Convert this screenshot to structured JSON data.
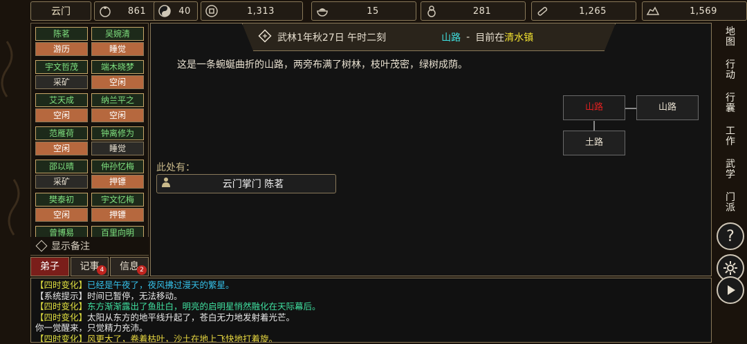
{
  "topbar": {
    "sect": "云门",
    "resources": [
      {
        "icon": "treasure-bag-icon",
        "value": "861"
      },
      {
        "icon": "yin-yang-icon",
        "value": "40"
      },
      {
        "icon": "coin-icon",
        "value": "1,313"
      },
      {
        "icon": "food-bowl-icon",
        "value": "15"
      },
      {
        "icon": "gourd-icon",
        "value": "281"
      },
      {
        "icon": "wood-log-icon",
        "value": "1,265"
      },
      {
        "icon": "ore-rock-icon",
        "value": "1,569"
      }
    ]
  },
  "disciples": [
    {
      "name": "陈茗",
      "status": "游历",
      "busy": true
    },
    {
      "name": "吴婉清",
      "status": "睡觉",
      "busy": true
    },
    {
      "name": "宇文哲茂",
      "status": "采矿",
      "busy": false
    },
    {
      "name": "端木晓梦",
      "status": "空闲",
      "busy": true
    },
    {
      "name": "艾天成",
      "status": "空闲",
      "busy": true
    },
    {
      "name": "纳兰平之",
      "status": "空闲",
      "busy": true
    },
    {
      "name": "范雁荷",
      "status": "空闲",
      "busy": true
    },
    {
      "name": "钟离修为",
      "status": "睡觉",
      "busy": false
    },
    {
      "name": "邵以晴",
      "status": "采矿",
      "busy": false
    },
    {
      "name": "仲孙忆梅",
      "status": "押镖",
      "busy": true
    },
    {
      "name": "樊泰初",
      "status": "空闲",
      "busy": true
    },
    {
      "name": "宇文忆梅",
      "status": "押镖",
      "busy": true
    },
    {
      "name": "曾博易",
      "status": "",
      "busy": true
    },
    {
      "name": "百里向明",
      "status": "",
      "busy": true
    }
  ],
  "memo_toggle": "显示备注",
  "tabs": [
    {
      "label": "弟子",
      "badge": ""
    },
    {
      "label": "记事",
      "badge": "4"
    },
    {
      "label": "信息",
      "badge": "2"
    }
  ],
  "header": {
    "date": "武林1年秋27日 午时二刻",
    "location": "山路",
    "separator": "-",
    "now_prefix": "目前在",
    "town": "清水镇"
  },
  "description": "这是一条蜿蜒曲折的山路，两旁布满了树林，枝叶茂密，绿树成荫。",
  "here_label": "此处有：",
  "npc": {
    "name": "云门掌门 陈茗"
  },
  "minimap": {
    "current": "山路",
    "east": "山路",
    "south": "土路"
  },
  "log": [
    {
      "tag": "【四时变化】",
      "text": "已经是午夜了，夜风拂过漫天的繁星。",
      "color": "#35c0e8"
    },
    {
      "tag": "【系统提示】",
      "text": "时间已暂停，无法移动。",
      "color": "#e8e8e8"
    },
    {
      "tag": "【四时变化】",
      "text": "东方渐渐露出了鱼肚白，明亮的启明星悄然融化在天际幕后。",
      "color": "#40e0a0"
    },
    {
      "tag": "【四时变化】",
      "text": "太阳从东方的地平线升起了，苍白无力地发射着光芒。",
      "color": "#e8e8e8"
    },
    {
      "tag": "",
      "text": "你一觉醒来，只觉精力充沛。",
      "color": "#e8e8e8"
    },
    {
      "tag": "【四时变化】",
      "text": "风更大了，卷着枯叶，沙土在地上飞快地打着旋。",
      "color": "#e8d840"
    }
  ],
  "sidebar": [
    {
      "name": "map",
      "label": "地图"
    },
    {
      "name": "action",
      "label": "行动"
    },
    {
      "name": "bag",
      "label": "行囊"
    },
    {
      "name": "work",
      "label": "工作"
    },
    {
      "name": "martial",
      "label": "武学"
    },
    {
      "name": "sect",
      "label": "门派"
    }
  ]
}
